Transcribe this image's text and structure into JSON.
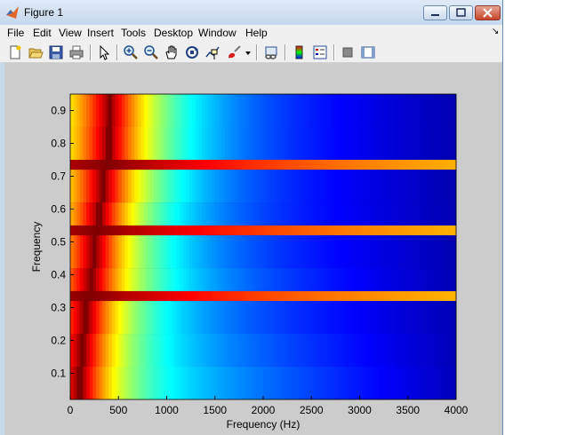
{
  "window": {
    "title": "Figure 1"
  },
  "menu": [
    "File",
    "Edit",
    "View",
    "Insert",
    "Tools",
    "Desktop",
    "Window",
    "Help"
  ],
  "menu_overflow": "↘",
  "toolbar": {
    "icons": [
      "new-figure-icon",
      "open-file-icon",
      "save-icon",
      "print-icon",
      "edit-plot-icon",
      "zoom-in-icon",
      "zoom-out-icon",
      "pan-icon",
      "rotate-3d-icon",
      "data-cursor-icon",
      "brush-icon",
      "link-plot-icon",
      "insert-colorbar-icon",
      "insert-legend-icon",
      "hide-plot-tools-icon",
      "show-plot-tools-icon"
    ]
  },
  "chart_data": {
    "type": "heatmap",
    "title": "",
    "xlabel": "Frequency (Hz)",
    "ylabel": "Frequency",
    "xlim": [
      0,
      4000
    ],
    "ylim": [
      0.02,
      0.95
    ],
    "x_ticks": [
      "0",
      "500",
      "1000",
      "1500",
      "2000",
      "2500",
      "3000",
      "3500",
      "4000"
    ],
    "y_ticks": [
      "0.1",
      "0.2",
      "0.3",
      "0.4",
      "0.5",
      "0.6",
      "0.7",
      "0.8",
      "0.9"
    ],
    "colormap": "jet",
    "background_color": "#00007f",
    "rows": [
      {
        "y_range": [
          0.02,
          0.12
        ],
        "peak_hz": 100,
        "baseline": 0.38,
        "decay_hz": 1200
      },
      {
        "y_range": [
          0.12,
          0.22
        ],
        "peak_hz": 125,
        "baseline": 0.34,
        "decay_hz": 1300
      },
      {
        "y_range": [
          0.22,
          0.32
        ],
        "peak_hz": 160,
        "baseline": 0.3,
        "decay_hz": 1400
      },
      {
        "y_range": [
          0.32,
          0.35
        ],
        "peak_hz": 200,
        "baseline": 0.62,
        "decay_hz": 8000
      },
      {
        "y_range": [
          0.35,
          0.42
        ],
        "peak_hz": 220,
        "baseline": 0.3,
        "decay_hz": 1500
      },
      {
        "y_range": [
          0.42,
          0.52
        ],
        "peak_hz": 250,
        "baseline": 0.27,
        "decay_hz": 1500
      },
      {
        "y_range": [
          0.52,
          0.55
        ],
        "peak_hz": 280,
        "baseline": 0.62,
        "decay_hz": 8000
      },
      {
        "y_range": [
          0.55,
          0.62
        ],
        "peak_hz": 300,
        "baseline": 0.26,
        "decay_hz": 1500
      },
      {
        "y_range": [
          0.62,
          0.72
        ],
        "peak_hz": 340,
        "baseline": 0.25,
        "decay_hz": 1600
      },
      {
        "y_range": [
          0.72,
          0.75
        ],
        "peak_hz": 380,
        "baseline": 0.62,
        "decay_hz": 8000
      },
      {
        "y_range": [
          0.75,
          0.85
        ],
        "peak_hz": 400,
        "baseline": 0.25,
        "decay_hz": 1700
      },
      {
        "y_range": [
          0.85,
          0.95
        ],
        "peak_hz": 410,
        "baseline": 0.25,
        "decay_hz": 1700
      }
    ]
  }
}
